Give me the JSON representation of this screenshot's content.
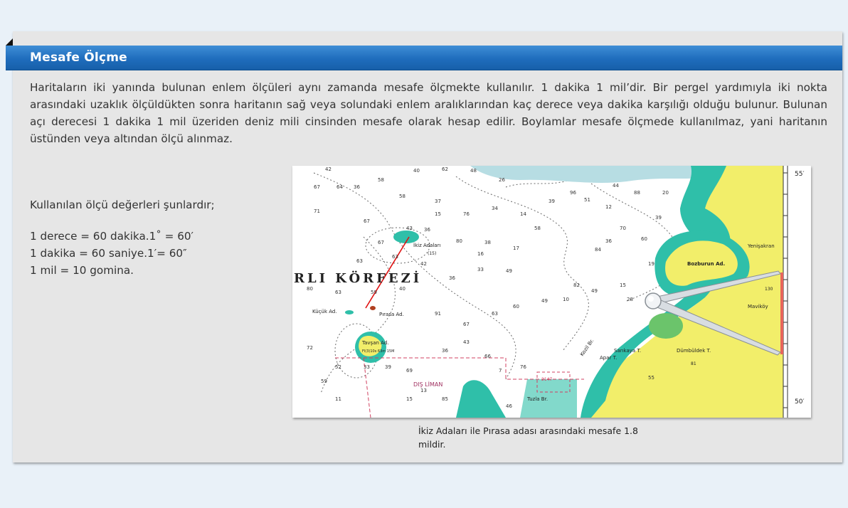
{
  "section": {
    "title": "Mesafe Ölçme",
    "paragraph": "Haritaların iki yanında bulunan enlem ölçüleri aynı zamanda mesafe ölçmekte kullanılır. 1 dakika 1 mil’dir. Bir pergel yardımıyla iki nokta arasındaki uzaklık ölçüldükten sonra haritanın sağ veya solundaki enlem aralıklarından kaç derece veya dakika karşılığı olduğu bulunur. Bulunan açı derecesi 1 dakika 1 mil üzeriden deniz mili cinsinden mesafe olarak hesap edilir. Boylamlar mesafe ölçmede kullanılmaz, yani haritanın üstünden veya altından ölçü alınmaz.",
    "units_intro": "Kullanılan ölçü değerleri şunlardır;",
    "units": [
      "1 derece = 60 dakika.1˚ = 60′",
      "1 dakika = 60 saniye.1′= 60″",
      "1 mil = 10 gomina."
    ]
  },
  "map": {
    "gulf_label": "RLI KÖRFEZİ",
    "place_labels": {
      "ikiz": "İkiz Adaları",
      "kucuk": "Küçük Ad.",
      "pirasa": "Pırasa Ad.",
      "tavsan": "Tavşan Ad.",
      "bozburun": "Bozburun Ad.",
      "yenisakran": "Yenişakran",
      "mavikoy": "Maviköy",
      "dis_liman": "DIŞ LİMAN",
      "kozil": "Kozil Br.",
      "apar": "Apar T.",
      "sarikaya": "Sarıkaya T.",
      "dumbuldek": "Dümbüldek T.",
      "tuzla": "Tuzla Br."
    },
    "latitude_labels": [
      "55′",
      "50′"
    ],
    "depths": [
      "42",
      "67",
      "64",
      "36",
      "58",
      "40",
      "62",
      "48",
      "26",
      "71",
      "67",
      "58",
      "37",
      "76",
      "34",
      "14",
      "58",
      "67",
      "43",
      "36",
      "15",
      "80",
      "38",
      "17",
      "16",
      "63",
      "63",
      "42",
      "36",
      "33",
      "49",
      "80",
      "63",
      "59",
      "40",
      "91",
      "67",
      "63",
      "60",
      "49",
      "10",
      "82",
      "49",
      "84",
      "36",
      "70",
      "60",
      "39",
      "88",
      "44",
      "72",
      "52",
      "33",
      "39",
      "69",
      "36",
      "43",
      "66",
      "59",
      "11",
      "15",
      "13",
      "85",
      "46",
      "19",
      "20",
      "39",
      "96",
      "51",
      "12",
      "15",
      "28",
      "7",
      "76",
      "55"
    ],
    "small_labels": [
      "(15)",
      "Fl(3)10s 63m 15M",
      "2147",
      "130",
      "81"
    ]
  },
  "caption": "İkiz Adaları ile Pırasa adası arasındaki mesafe 1.8 mildir."
}
